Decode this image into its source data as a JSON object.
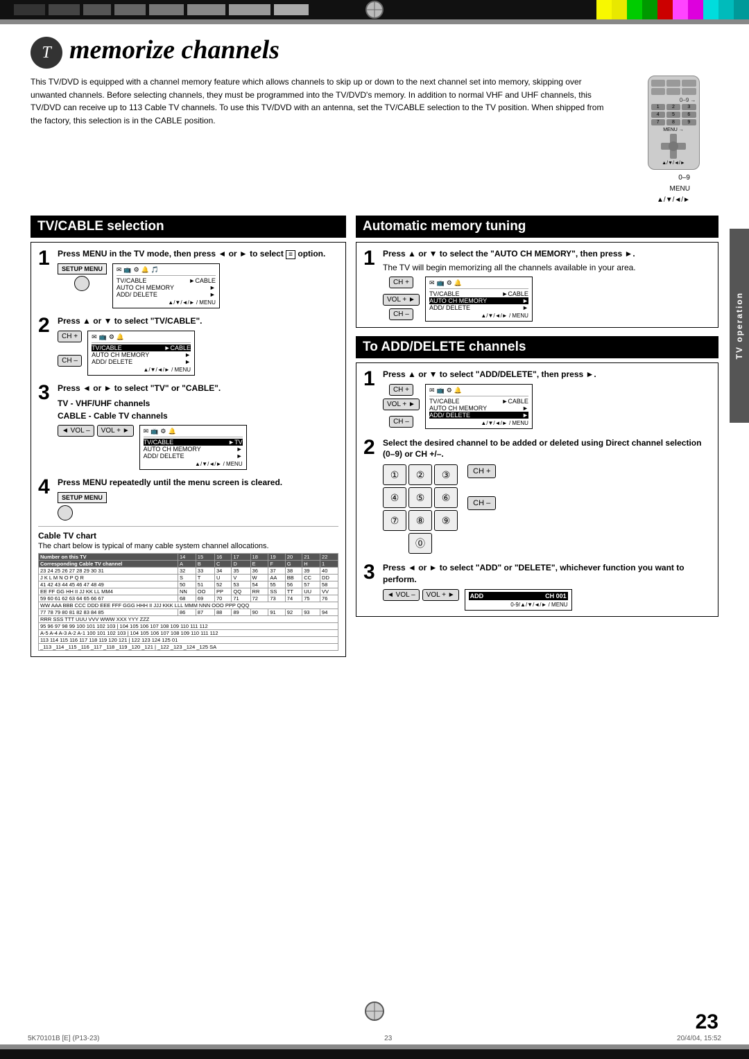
{
  "page": {
    "number": "23",
    "footer_left": "5K70101B [E] (P13-23)",
    "footer_center": "23",
    "footer_right": "20/4/04, 15:52"
  },
  "top_bar": {
    "black_blocks": [
      "40px",
      "40px",
      "40px",
      "40px",
      "40px",
      "60px",
      "60px",
      "40px"
    ],
    "color_blocks": [
      "#ff0",
      "#ff0",
      "#ff0",
      "#0f0",
      "#0f0",
      "#0f0",
      "#0f0",
      "#f00",
      "#f00",
      "#f0f",
      "#f0f",
      "#0ff",
      "#0ff",
      "#0ff"
    ]
  },
  "title": {
    "icon_text": "T",
    "main": "memorize channels"
  },
  "intro": {
    "text": "This TV/DVD is equipped with a channel memory feature which allows channels to skip up or down to the next channel set into memory, skipping over unwanted channels. Before selecting channels, they must be programmed into the TV/DVD's memory. In addition to normal VHF and UHF channels, this TV/DVD can receive up to 113 Cable TV channels. To use this TV/DVD with an antenna, set the TV/CABLE selection to the TV position. When shipped from the factory, this selection is in the CABLE position."
  },
  "remote_labels": {
    "line1": "0–9",
    "line2": "MENU",
    "line3": "▲/▼/◄/►"
  },
  "tv_cable": {
    "header": "TV/CABLE selection",
    "step1": {
      "number": "1",
      "instruction": "Press MENU in the TV mode, then press ◄ or ► to select  option.",
      "screen": {
        "icons": "✉ 📺 ⚙ 🔔",
        "rows": [
          {
            "label": "TV/CABLE",
            "value": "►CABLE"
          },
          {
            "label": "AUTO CH MEMORY",
            "value": "►",
            "highlight": false
          },
          {
            "label": "ADD/ DELETE",
            "value": "►"
          }
        ],
        "nav": "▲/▼/◄/► / MENU"
      }
    },
    "step2": {
      "number": "2",
      "instruction": "Press ▲ or ▼ to select \"TV/CABLE\".",
      "screen": {
        "rows": [
          {
            "label": "TV/CABLE",
            "value": "►CABLE",
            "highlight": true
          },
          {
            "label": "AUTO CH MEMORY",
            "value": "►"
          },
          {
            "label": "ADD/ DELETE",
            "value": "►"
          }
        ],
        "nav": "▲/▼/◄/► / MENU"
      }
    },
    "step3": {
      "number": "3",
      "instruction": "Press ◄ or ► to select \"TV\" or \"CABLE\".",
      "sub1": "TV - VHF/UHF channels",
      "sub2": "CABLE - Cable TV channels",
      "screen": {
        "rows": [
          {
            "label": "TV/CABLE",
            "value": "►TV",
            "highlight": true
          },
          {
            "label": "AUTO CH MEMORY",
            "value": "►"
          },
          {
            "label": "ADD/ DELETE",
            "value": "►"
          }
        ],
        "nav": "▲/▼/◄/► / MENU"
      }
    },
    "step4": {
      "number": "4",
      "instruction": "Press MENU repeatedly until the menu screen is cleared."
    }
  },
  "cable_chart": {
    "title": "Cable TV chart",
    "description": "The chart below is typical of many cable system channel allocations.",
    "header_row": [
      "Number on this TV",
      "14",
      "15",
      "16",
      "17",
      "18",
      "19",
      "20",
      "21",
      "22"
    ],
    "header_row2": [
      "Corresponding Cable TV channel",
      "A",
      "B",
      "C",
      "D",
      "E",
      "F",
      "G",
      "H",
      "1"
    ],
    "rows": [
      [
        "23",
        "24",
        "25",
        "26",
        "27",
        "28",
        "29",
        "30",
        "31",
        "32",
        "33",
        "34",
        "35",
        "36",
        "37",
        "38",
        "39",
        "40"
      ],
      [
        "J",
        "K",
        "L",
        "M",
        "N",
        "O",
        "P",
        "Q",
        "R",
        "S",
        "T",
        "U",
        "V",
        "W",
        "AA",
        "BB",
        "CC",
        "DD"
      ],
      [
        "41",
        "42",
        "43",
        "44",
        "45",
        "46",
        "47",
        "48",
        "49",
        "50",
        "51",
        "52",
        "53",
        "54",
        "55",
        "56",
        "57",
        "58"
      ],
      [
        "EE",
        "FF",
        "GG",
        "HH",
        "II",
        "JJ",
        "KK",
        "LL",
        "MM4",
        "NN",
        "OO",
        "PP",
        "QQ",
        "RR",
        "SS",
        "TT",
        "UU",
        "VV"
      ],
      [
        "59",
        "60",
        "61",
        "62",
        "63",
        "64",
        "65",
        "66",
        "67",
        "68",
        "69",
        "70",
        "71",
        "72",
        "73",
        "74",
        "75",
        "76"
      ],
      [
        "WW",
        "AAA",
        "BBB",
        "CCC",
        "DDD",
        "EEE",
        "FFF",
        "GGG",
        "HHH",
        "II",
        "JJJ",
        "KKK",
        "LLL",
        "MMM",
        "NNN",
        "OOO",
        "PPP",
        "QQQ"
      ],
      [
        "77",
        "78",
        "79",
        "80",
        "81",
        "82",
        "83",
        "84",
        "85",
        "86",
        "87",
        "88",
        "89",
        "90",
        "91",
        "92",
        "93",
        "94"
      ],
      [
        "RRR",
        "SSS",
        "TTT",
        "UUU",
        "VVV",
        "WWW",
        "XXX",
        "YYY",
        "ZZZ",
        "",
        "",
        "",
        "",
        "",
        "",
        "",
        "",
        ""
      ],
      [
        "95",
        "96",
        "97",
        "98",
        "99",
        "100",
        "101",
        "102",
        "103",
        "104",
        "105",
        "106",
        "107",
        "108",
        "109",
        "110",
        "111",
        "112"
      ],
      [
        "A-5",
        "A-4",
        "A-3",
        "A-2",
        "A-1",
        "100",
        "101",
        "102",
        "103",
        "104",
        "105",
        "106",
        "107",
        "108",
        "109",
        "110",
        "111",
        "112"
      ],
      [
        "113",
        "114",
        "115",
        "116",
        "117",
        "118",
        "119",
        "120",
        "121",
        "122",
        "123",
        "124",
        "125",
        "01"
      ],
      [
        "_113",
        "_114",
        "_115",
        "_116",
        "_117",
        "_118",
        "_119",
        "_120",
        "_121",
        "_122",
        "_123",
        "_124",
        "_125",
        "SA"
      ]
    ]
  },
  "auto_memory": {
    "header": "Automatic memory tuning",
    "step1": {
      "number": "1",
      "instruction": "Press ▲ or ▼ to select the \"AUTO CH MEMORY\", then press ►.",
      "description": "The TV will begin memorizing all the channels available in your area.",
      "screen": {
        "rows": [
          {
            "label": "TV/CABLE",
            "value": "►CABLE"
          },
          {
            "label": "AUTO CH MEMORY",
            "value": "►",
            "highlight": true
          },
          {
            "label": "ADD/ DELETE",
            "value": "►"
          }
        ],
        "nav": "▲/▼/◄/► / MENU"
      }
    }
  },
  "add_delete": {
    "header": "To ADD/DELETE channels",
    "step1": {
      "number": "1",
      "instruction": "Press ▲ or ▼ to select \"ADD/DELETE\", then press ►.",
      "screen": {
        "rows": [
          {
            "label": "TV/CABLE",
            "value": "►CABLE"
          },
          {
            "label": "AUTO CH MEMORY",
            "value": "►"
          },
          {
            "label": "ADD/ DELETE",
            "value": "►",
            "highlight": true
          }
        ],
        "nav": "▲/▼/◄/► / MENU"
      }
    },
    "step2": {
      "number": "2",
      "instruction": "Select the desired channel to be added or deleted using Direct channel selection (0–9) or CH +/–.",
      "numbers": [
        "1",
        "2",
        "3",
        "4",
        "5",
        "6",
        "7",
        "8",
        "9",
        "0"
      ]
    },
    "step3": {
      "number": "3",
      "instruction": "Press ◄ or ► to select \"ADD\" or \"DELETE\", whichever function you want to perform.",
      "screen_label_left": "◄ VOL –",
      "screen_label_right": "VOL + ►",
      "add_label": "ADD",
      "ch_label": "CH 001",
      "nav": "0-9/▲/▼/◄/► / MENU"
    }
  },
  "sidebar": {
    "label": "TV operation"
  },
  "buttons": {
    "setup_menu": "SETUP MENU",
    "vol_minus": "◄ VOL –",
    "vol_plus": "VOL + ►",
    "ch_plus": "CH +",
    "ch_minus": "CH –"
  }
}
